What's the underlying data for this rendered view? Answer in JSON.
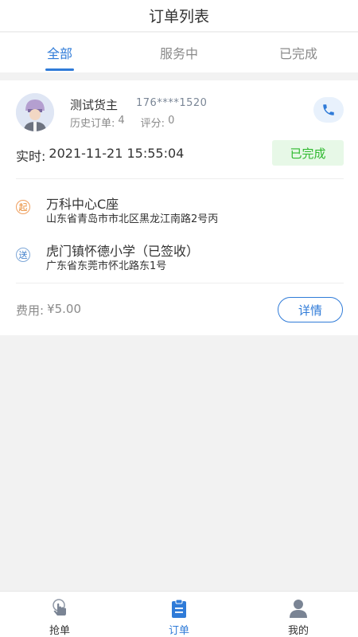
{
  "header": {
    "title": "订单列表"
  },
  "tabs": [
    {
      "label": "全部",
      "active": true
    },
    {
      "label": "服务中",
      "active": false
    },
    {
      "label": "已完成",
      "active": false
    }
  ],
  "order": {
    "owner_name": "测试货主",
    "owner_phone": "176****1520",
    "history_label": "历史订单:",
    "history_count": "4",
    "rating_label": "评分:",
    "rating_value": "0",
    "time_label": "实时:",
    "time_value": "2021-11-21 15:55:04",
    "status": "已完成",
    "pickup": {
      "icon_text": "起",
      "name": "万科中心C座",
      "address": "山东省青岛市市北区黑龙江南路2号丙"
    },
    "delivery": {
      "icon_text": "送",
      "name": "虎门镇怀德小学（已签收）",
      "address": "广东省东莞市怀北路东1号"
    },
    "fee_label": "费用:",
    "fee_value": "¥5.00",
    "detail_label": "详情"
  },
  "bottom_nav": [
    {
      "label": "抢单",
      "icon": "hand-tap-icon",
      "active": false
    },
    {
      "label": "订单",
      "icon": "clipboard-icon",
      "active": true
    },
    {
      "label": "我的",
      "icon": "user-icon",
      "active": false
    }
  ],
  "colors": {
    "accent": "#2f7bd8",
    "status_done": "#2eb82e",
    "status_done_bg": "#e7f8e7",
    "pickup": "#e8872e",
    "background": "#f2f2f2"
  }
}
